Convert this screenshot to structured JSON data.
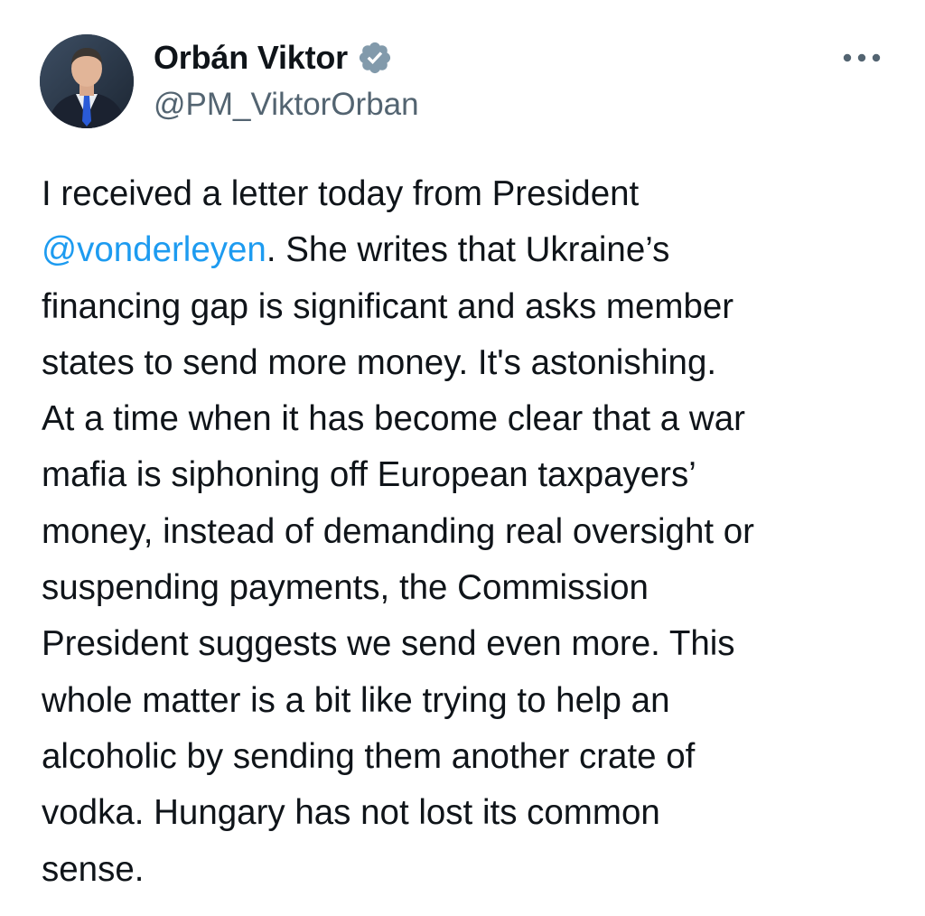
{
  "author": {
    "display_name": "Orbán Viktor",
    "handle": "@PM_ViktorOrban",
    "verified": true,
    "avatar_icon": "profile-photo"
  },
  "menu": {
    "icon": "more-horizontal-icon"
  },
  "tweet": {
    "lines": [
      {
        "text": "I received a letter today from President"
      },
      {
        "mention": "@vonderleyen",
        "text": ". She writes that Ukraine’s"
      },
      {
        "text": "financing gap is significant and asks member"
      },
      {
        "text": "states to send more money. It's astonishing."
      },
      {
        "text": "At a time when it has become clear that a war"
      },
      {
        "text": "mafia is siphoning off European taxpayers’"
      },
      {
        "text": "money, instead of demanding real oversight or"
      },
      {
        "text": "suspending payments, the Commission"
      },
      {
        "text": "President suggests we send even more. This"
      },
      {
        "text": "whole matter is a bit like trying to help an"
      },
      {
        "text": "alcoholic by sending them another crate of"
      },
      {
        "text": "vodka. Hungary has not lost its common"
      },
      {
        "text": "sense."
      }
    ]
  },
  "colors": {
    "text": "#0f1419",
    "secondary": "#536471",
    "link": "#1d9bf0",
    "verified_badge": "#829aab"
  }
}
